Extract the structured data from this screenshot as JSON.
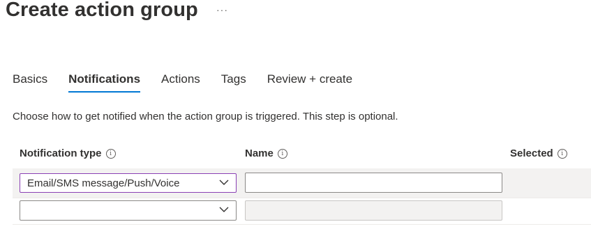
{
  "page": {
    "title": "Create action group",
    "more_label": "···"
  },
  "tabs": [
    {
      "label": "Basics",
      "active": false
    },
    {
      "label": "Notifications",
      "active": true
    },
    {
      "label": "Actions",
      "active": false
    },
    {
      "label": "Tags",
      "active": false
    },
    {
      "label": "Review + create",
      "active": false
    }
  ],
  "description": "Choose how to get notified when the action group is triggered. This step is optional.",
  "table": {
    "columns": [
      {
        "label": "Notification type",
        "info": "i"
      },
      {
        "label": "Name",
        "info": "i"
      },
      {
        "label": "Selected",
        "info": "i"
      }
    ],
    "rows": [
      {
        "type_value": "Email/SMS message/Push/Voice",
        "name_value": ""
      },
      {
        "type_value": "",
        "name_value": ""
      }
    ]
  },
  "colors": {
    "accent": "#0078d4",
    "focus_border": "#8a3fb4",
    "row_bg": "#f3f2f1"
  }
}
